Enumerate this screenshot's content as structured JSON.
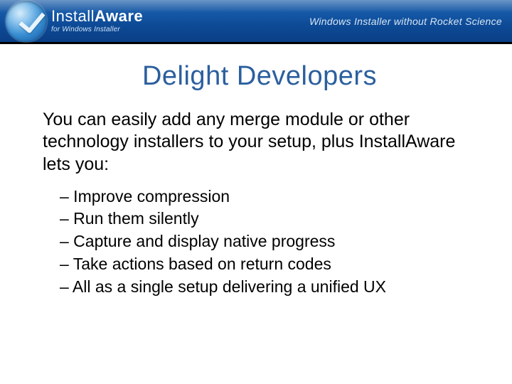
{
  "header": {
    "brand_prefix": "Install",
    "brand_suffix": "Aware",
    "brand_sub": "for Windows Installer",
    "tagline": "Windows Installer without Rocket Science"
  },
  "slide": {
    "title": "Delight Developers",
    "intro": "You can easily add any merge module or other technology installers to your setup, plus InstallAware lets you:",
    "bullets": [
      "– Improve compression",
      "– Run them silently",
      "– Capture and display native progress",
      "– Take actions based on return codes",
      "– All as a single setup delivering a unified UX"
    ]
  }
}
